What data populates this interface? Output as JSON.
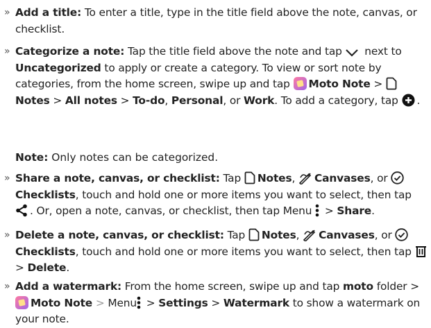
{
  "items": {
    "title": {
      "bullet": "»",
      "heading": "Add a title:",
      "text": " To enter a title, type in the title field above the note, canvas, or checklist."
    },
    "categorize": {
      "bullet": "»",
      "heading": "Categorize a note:",
      "t1": " Tap the title field above the note and tap ",
      "t2": " next to ",
      "uncategorized": "Uncategorized",
      "t3": " to apply or create a category. To view or sort note by categories, from the home screen, swipe up and tap ",
      "moto_note": "Moto Note",
      "sep1": " > ",
      "notes": "Notes",
      "sep2": " > ",
      "all_notes": "All notes",
      "sep3": " > ",
      "todo": "To-do",
      "comma": ", ",
      "personal": "Personal",
      "or": ", or ",
      "work": "Work",
      "t4": ". To add a category, tap ",
      "end": "."
    },
    "note": {
      "label": "Note:",
      "text": " Only notes can be categorized."
    },
    "share": {
      "bullet": "»",
      "heading": "Share a note, canvas, or checklist:",
      "t1": " Tap ",
      "notes": "Notes",
      "c1": ", ",
      "canvases": "Canvases",
      "or": ", or ",
      "checklists": "Checklists",
      "t2": ", touch and hold one or more items you want to select, then tap ",
      "t3": ". Or, open a note, canvas, or checklist, then tap Menu ",
      "sep": " > ",
      "share_label": "Share",
      "end": "."
    },
    "delete": {
      "bullet": "»",
      "heading": "Delete a note, canvas, or checklist:",
      "t1": " Tap ",
      "notes": "Notes",
      "c1": ", ",
      "canvases": "Canvases",
      "or": ", or ",
      "checklists": "Checklists",
      "t2": ", touch and hold one or more items you want to select, then tap ",
      "sep": " > ",
      "delete_label": "Delete",
      "end": "."
    },
    "watermark": {
      "bullet": "»",
      "heading": "Add a watermark:",
      "t1": "  From the home screen, swipe up and tap ",
      "moto": "moto",
      "t2": " folder > ",
      "moto_note": "Moto Note",
      "sep1": " > ",
      "menu": "Menu",
      "sep2": " > ",
      "settings": "Settings",
      "sep3": " > ",
      "watermark_label": "Watermark",
      "t3": " to show a watermark on your note."
    }
  },
  "icons": {
    "chevron": "chevron-down-icon",
    "app": "moto-note-app-icon",
    "note": "note-icon",
    "add": "add-circle-icon",
    "canvas": "canvas-icon",
    "checklist": "checklist-icon",
    "share": "share-icon",
    "menu": "menu-dots-icon",
    "trash": "trash-icon"
  }
}
